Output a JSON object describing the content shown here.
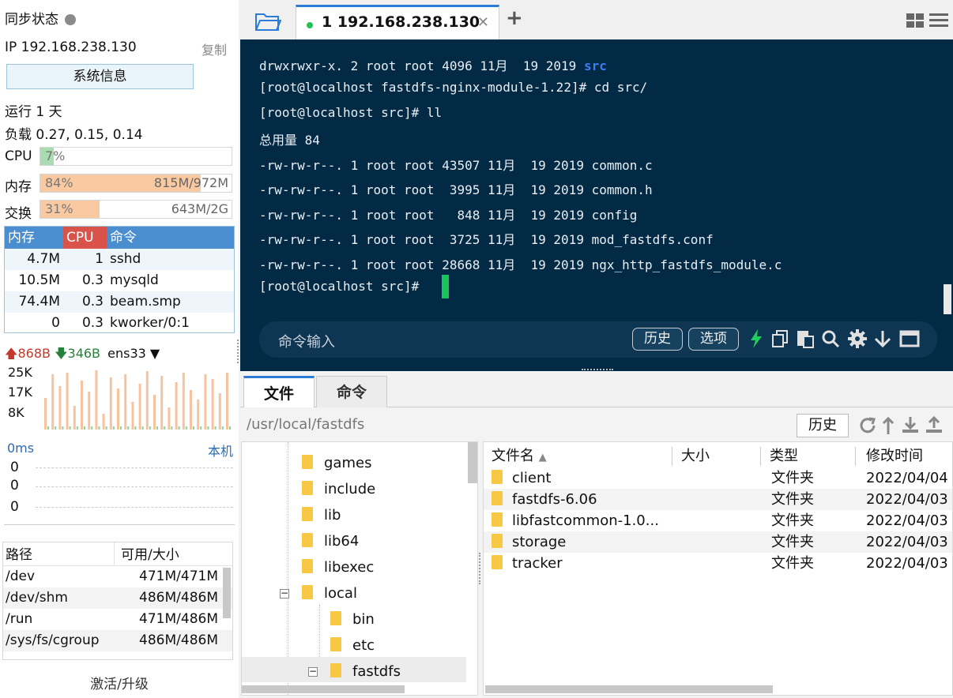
{
  "sidebar": {
    "sync_status": "同步状态",
    "ip_label": "IP 192.168.238.130",
    "copy_label": "复制",
    "sysinfo_button": "系统信息",
    "uptime": "运行 1 天",
    "load": "负载 0.27, 0.15, 0.14",
    "cpu": {
      "label": "CPU",
      "pct_text": "7%",
      "level": 0.07
    },
    "mem": {
      "label": "内存",
      "pct_text": "84%",
      "detail": "815M/972M",
      "level": 0.84
    },
    "swap": {
      "label": "交换",
      "pct_text": "31%",
      "detail": "643M/2G",
      "level": 0.31
    },
    "proc_headers": [
      "内存",
      "CPU",
      "命令"
    ],
    "processes": [
      {
        "mem": "4.7M",
        "cpu": "1",
        "cmd": "sshd"
      },
      {
        "mem": "10.5M",
        "cpu": "0.3",
        "cmd": "mysqld"
      },
      {
        "mem": "74.4M",
        "cpu": "0.3",
        "cmd": "beam.smp"
      },
      {
        "mem": "0",
        "cpu": "0.3",
        "cmd": "kworker/0:1"
      }
    ],
    "net": {
      "up": "868B",
      "down": "346B",
      "iface": "ens33",
      "ticks": [
        "25K",
        "17K",
        "8K"
      ]
    },
    "latency": {
      "value": "0ms",
      "host": "本机",
      "ticks": [
        "0",
        "0",
        "0"
      ]
    },
    "disk_headers": [
      "路径",
      "可用/大小"
    ],
    "disks": [
      {
        "path": "/dev",
        "size": "471M/471M"
      },
      {
        "path": "/dev/shm",
        "size": "486M/486M"
      },
      {
        "path": "/run",
        "size": "471M/486M"
      },
      {
        "path": "/sys/fs/cgroup",
        "size": "486M/486M"
      }
    ],
    "activate": "激活/升级"
  },
  "tabs": {
    "active_title": "1 192.168.238.130",
    "add": "+"
  },
  "terminal": {
    "lines": [
      "drwxrwxr-x. 2 root root 4096 11月  19 2019 ",
      "[root@localhost fastdfs-nginx-module-1.22]# cd src/",
      "[root@localhost src]# ll",
      "总用量 84",
      "-rw-rw-r--. 1 root root 43507 11月  19 2019 common.c",
      "-rw-rw-r--. 1 root root  3995 11月  19 2019 common.h",
      "-rw-rw-r--. 1 root root   848 11月  19 2019 config",
      "-rw-rw-r--. 1 root root  3725 11月  19 2019 mod_fastdfs.conf",
      "-rw-rw-r--. 1 root root 28668 11月  19 2019 ngx_http_fastdfs_module.c",
      "[root@localhost src]# "
    ],
    "highlight": "src",
    "highlight_color": "#3d7cf5",
    "cmd_placeholder": "命令输入",
    "history_btn": "历史",
    "options_btn": "选项"
  },
  "bottom": {
    "tab_files": "文件",
    "tab_commands": "命令",
    "path": "/usr/local/fastdfs",
    "history_btn": "历史",
    "tree": [
      {
        "name": "games",
        "depth": 1
      },
      {
        "name": "include",
        "depth": 1
      },
      {
        "name": "lib",
        "depth": 1
      },
      {
        "name": "lib64",
        "depth": 1
      },
      {
        "name": "libexec",
        "depth": 1
      },
      {
        "name": "local",
        "depth": 1,
        "expanded": true
      },
      {
        "name": "bin",
        "depth": 2
      },
      {
        "name": "etc",
        "depth": 2
      },
      {
        "name": "fastdfs",
        "depth": 2,
        "expanded": true,
        "selected": true
      }
    ],
    "file_headers": [
      "文件名",
      "大小",
      "类型",
      "修改时间"
    ],
    "files": [
      {
        "name": "client",
        "size": "",
        "type": "文件夹",
        "mtime": "2022/04/04"
      },
      {
        "name": "fastdfs-6.06",
        "size": "",
        "type": "文件夹",
        "mtime": "2022/04/03"
      },
      {
        "name": "libfastcommon-1.0...",
        "size": "",
        "type": "文件夹",
        "mtime": "2022/04/03"
      },
      {
        "name": "storage",
        "size": "",
        "type": "文件夹",
        "mtime": "2022/04/03"
      },
      {
        "name": "tracker",
        "size": "",
        "type": "文件夹",
        "mtime": "2022/04/03"
      }
    ]
  },
  "colors": {
    "accent": "#2b7bd8",
    "terminal_bg": "#032a45",
    "cursor": "#16c55b",
    "mem_fill": "#f9c9a1",
    "cpu_fill": "#a9ddb1"
  }
}
